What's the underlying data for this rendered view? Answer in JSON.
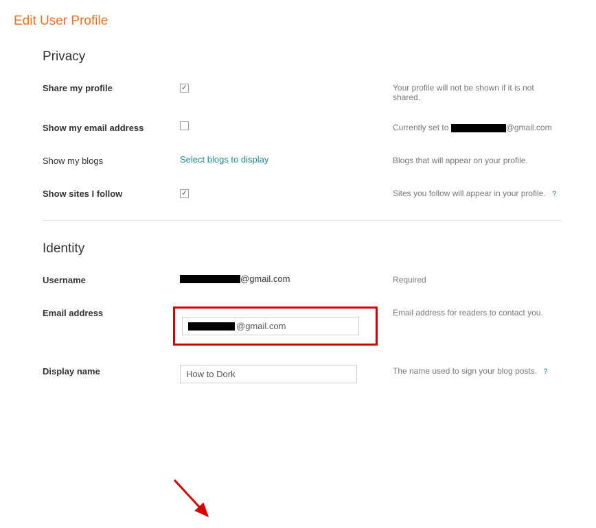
{
  "page_title": "Edit User Profile",
  "privacy": {
    "title": "Privacy",
    "share_profile": {
      "label": "Share my profile",
      "checked": true,
      "desc": "Your profile will not be shown if it is not shared."
    },
    "show_email": {
      "label": "Show my email address",
      "checked": false,
      "desc_prefix": "Currently set to ",
      "desc_suffix": "@gmail.com"
    },
    "show_blogs": {
      "label": "Show my blogs",
      "link": "Select blogs to display",
      "desc": "Blogs that will appear on your profile."
    },
    "show_sites": {
      "label": "Show sites I follow",
      "checked": true,
      "desc": "Sites you follow will appear in your profile."
    }
  },
  "identity": {
    "title": "Identity",
    "username": {
      "label": "Username",
      "suffix": "@gmail.com",
      "desc": "Required"
    },
    "email": {
      "label": "Email address",
      "suffix": "@gmail.com",
      "desc": "Email address for readers to contact you."
    },
    "display_name": {
      "label": "Display name",
      "value": "How to Dork",
      "desc": "The name used to sign your blog posts."
    }
  },
  "help_icon": "?"
}
